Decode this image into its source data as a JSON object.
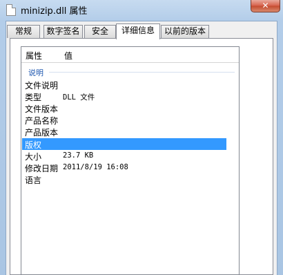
{
  "window": {
    "title": "minizip.dll 属性",
    "close_symbol": "✕"
  },
  "tabs": [
    {
      "label": "常规"
    },
    {
      "label": "数字签名"
    },
    {
      "label": "安全"
    },
    {
      "label": "详细信息",
      "active": true
    },
    {
      "label": "以前的版本"
    }
  ],
  "list": {
    "columns": {
      "property": "属性",
      "value": "值"
    },
    "group": "说明",
    "rows": [
      {
        "name": "文件说明",
        "value": ""
      },
      {
        "name": "类型",
        "value": "DLL 文件"
      },
      {
        "name": "文件版本",
        "value": ""
      },
      {
        "name": "产品名称",
        "value": ""
      },
      {
        "name": "产品版本",
        "value": ""
      },
      {
        "name": "版权",
        "value": "",
        "selected": true
      },
      {
        "name": "大小",
        "value": "23.7 KB"
      },
      {
        "name": "修改日期",
        "value": "2011/8/19 16:08"
      },
      {
        "name": "语言",
        "value": ""
      }
    ]
  },
  "colors": {
    "selection": "#3399ff",
    "group_label": "#1e57b0",
    "window_frame": "#a9c6e4"
  }
}
